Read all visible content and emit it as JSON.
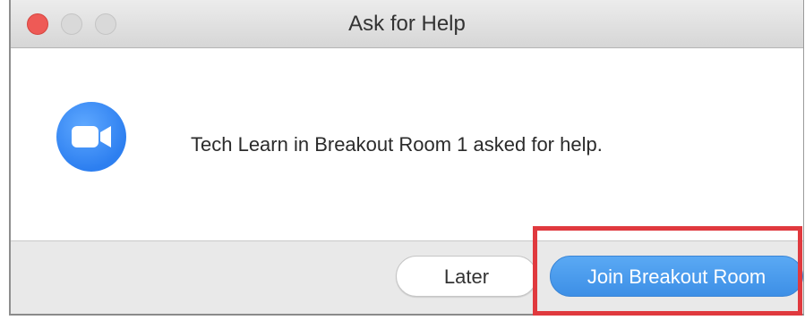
{
  "window": {
    "title": "Ask for Help"
  },
  "dialog": {
    "icon": "zoom-video-camera-icon",
    "message": "Tech Learn in Breakout Room 1 asked for help."
  },
  "buttons": {
    "later_label": "Later",
    "join_label": "Join Breakout Room"
  },
  "colors": {
    "accent": "#3d8fe6",
    "highlight": "#e0393e",
    "close_button": "#ee5a56"
  }
}
